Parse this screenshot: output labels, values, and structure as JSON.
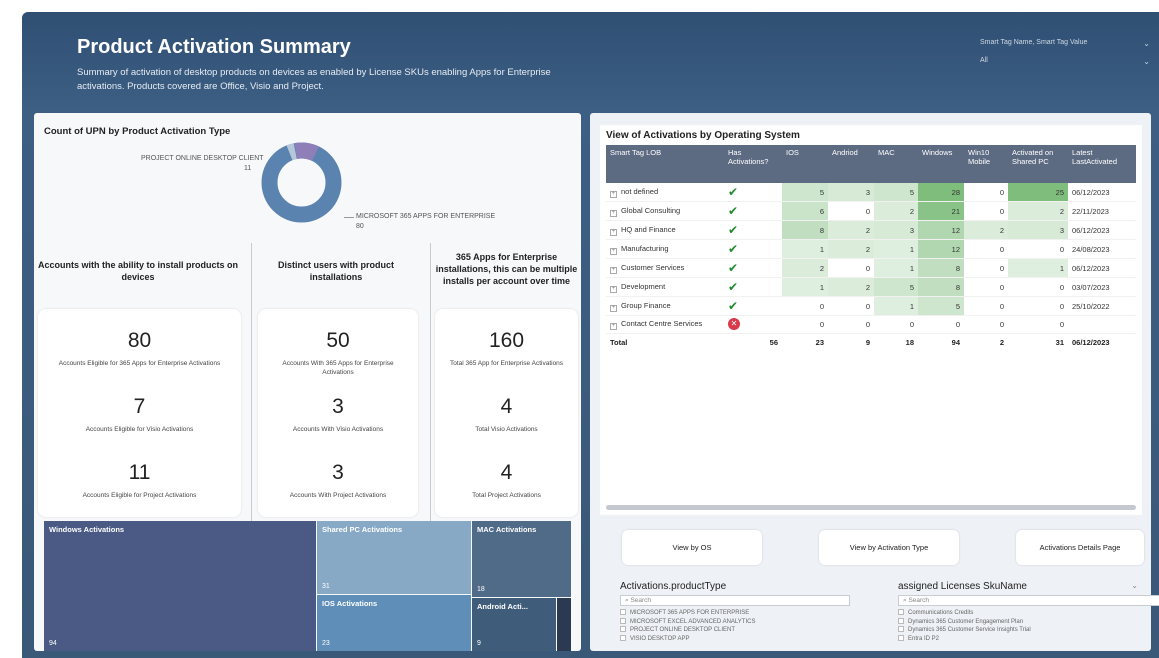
{
  "header": {
    "title": "Product Activation Summary",
    "subtitle": "Summary of activation of desktop products on devices as enabled by License SKUs enabling Apps for Enterprise activations. Products covered are Office, Visio and Project.",
    "slicer_label": "Smart Tag Name, Smart Tag Value",
    "slicer_value": "All"
  },
  "donut": {
    "title": "Count of UPN by Product Activation Type",
    "segments": [
      {
        "label": "MICROSOFT 365 APPS FOR ENTERPRISE",
        "value": "80",
        "color": "#5b83b0"
      },
      {
        "label": "PROJECT ONLINE DESKTOP CLIENT",
        "value": "11",
        "color": "#8e7fb8"
      }
    ],
    "small_slice_color": "#b7c6d8"
  },
  "kpis": [
    {
      "heading": "Accounts with the ability to install products on devices",
      "items": [
        {
          "value": "80",
          "label": "Accounts Eligible for 365 Apps for Enterprise Activations"
        },
        {
          "value": "7",
          "label": "Accounts Eligible for Visio Activations"
        },
        {
          "value": "11",
          "label": "Accounts Eligible for Project Activations"
        }
      ]
    },
    {
      "heading": "Distinct users with product installations",
      "items": [
        {
          "value": "50",
          "label": "Accounts With 365 Apps for Enterprise Activations"
        },
        {
          "value": "3",
          "label": "Accounts With Visio Activations"
        },
        {
          "value": "3",
          "label": "Accounts With Project Activations"
        }
      ]
    },
    {
      "heading": "365 Apps for Enterprise installations, this can be multiple installs per account over time",
      "items": [
        {
          "value": "160",
          "label": "Total 365 App for Enterprise Activations"
        },
        {
          "value": "4",
          "label": "Total Visio Activations"
        },
        {
          "value": "4",
          "label": "Total Project Activations"
        }
      ]
    }
  ],
  "treemap": [
    {
      "label": "Windows Activations",
      "value": "94",
      "color": "#4a5a84"
    },
    {
      "label": "Shared PC Activations",
      "value": "31",
      "color": "#87a9c6"
    },
    {
      "label": "MAC Activations",
      "value": "18",
      "color": "#4f6b88"
    },
    {
      "label": "IOS Activations",
      "value": "23",
      "color": "#5f8fb8"
    },
    {
      "label": "Android Acti...",
      "value": "9",
      "color": "#3f5c7a"
    }
  ],
  "table": {
    "title": "View of Activations by Operating System",
    "columns": [
      "Smart Tag LOB",
      "Has Activations?",
      "IOS",
      "Andriod",
      "MAC",
      "Windows",
      "Win10 Mobile",
      "Activated on Shared PC",
      "Latest LastActivated"
    ],
    "rows": [
      {
        "lob": "not defined",
        "has": true,
        "ios": "5",
        "android": "3",
        "mac": "5",
        "windows": "28",
        "win10": "0",
        "shared": "25",
        "latest": "06/12/2023"
      },
      {
        "lob": "Global Consulting",
        "has": true,
        "ios": "6",
        "android": "0",
        "mac": "2",
        "windows": "21",
        "win10": "0",
        "shared": "2",
        "latest": "22/11/2023"
      },
      {
        "lob": "HQ and Finance",
        "has": true,
        "ios": "8",
        "android": "2",
        "mac": "3",
        "windows": "12",
        "win10": "2",
        "shared": "3",
        "latest": "06/12/2023"
      },
      {
        "lob": "Manufacturing",
        "has": true,
        "ios": "1",
        "android": "2",
        "mac": "1",
        "windows": "12",
        "win10": "0",
        "shared": "0",
        "latest": "24/08/2023"
      },
      {
        "lob": "Customer Services",
        "has": true,
        "ios": "2",
        "android": "0",
        "mac": "1",
        "windows": "8",
        "win10": "0",
        "shared": "1",
        "latest": "06/12/2023"
      },
      {
        "lob": "Development",
        "has": true,
        "ios": "1",
        "android": "2",
        "mac": "5",
        "windows": "8",
        "win10": "0",
        "shared": "0",
        "latest": "03/07/2023"
      },
      {
        "lob": "Group Finance",
        "has": true,
        "ios": "0",
        "android": "0",
        "mac": "1",
        "windows": "5",
        "win10": "0",
        "shared": "0",
        "latest": "25/10/2022"
      },
      {
        "lob": "Contact Centre Services",
        "has": false,
        "ios": "0",
        "android": "0",
        "mac": "0",
        "windows": "0",
        "win10": "0",
        "shared": "0",
        "latest": ""
      }
    ],
    "total": {
      "label": "Total",
      "has": "56",
      "ios": "23",
      "android": "9",
      "mac": "18",
      "windows": "94",
      "win10": "2",
      "shared": "31",
      "latest": "06/12/2023"
    }
  },
  "buttons": [
    "View by OS",
    "View by Activation Type",
    "Activations Details Page"
  ],
  "slicers": [
    {
      "title": "Activations.productType",
      "search": "Search",
      "options": [
        "MICROSOFT 365 APPS FOR ENTERPRISE",
        "MICROSOFT EXCEL ADVANCED ANALYTICS",
        "PROJECT ONLINE DESKTOP CLIENT",
        "VISIO DESKTOP APP"
      ]
    },
    {
      "title": "assigned Licenses SkuName",
      "search": "Search",
      "options": [
        "Communications Credits",
        "Dynamics 365 Customer Engagement Plan",
        "Dynamics 365 Customer Service Insights Trial",
        "Entra ID P2"
      ]
    }
  ]
}
